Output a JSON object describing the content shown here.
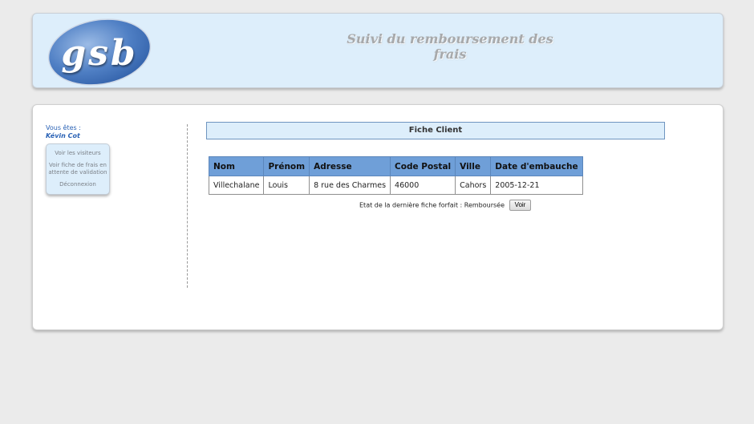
{
  "header": {
    "logo_text": "gsb",
    "site_title": "Suivi du remboursement des frais"
  },
  "sidebar": {
    "you_are_label": "Vous êtes :",
    "user_name": "Kévin Cot",
    "menu": [
      {
        "label": "Voir les visiteurs"
      },
      {
        "label": "Voir fiche de frais en attente de validation"
      },
      {
        "label": "Déconnexion"
      }
    ]
  },
  "main": {
    "panel_title": "Fiche Client",
    "table": {
      "headers": [
        "Nom",
        "Prénom",
        "Adresse",
        "Code Postal",
        "Ville",
        "Date d'embauche"
      ],
      "rows": [
        [
          "Villechalane",
          "Louis",
          "8 rue des Charmes",
          "46000",
          "Cahors",
          "2005-12-21"
        ]
      ]
    },
    "status_text": "Etat de la dernière fiche forfait : Remboursée",
    "voir_label": "Voir"
  },
  "colors": {
    "page_bg": "#ebebeb",
    "header_bg": "#ddeefb",
    "table_header_bg": "#6f9fd8",
    "link_blue": "#2a62b5"
  },
  "icons": {
    "logo": "gsb-logo-ellipse"
  }
}
